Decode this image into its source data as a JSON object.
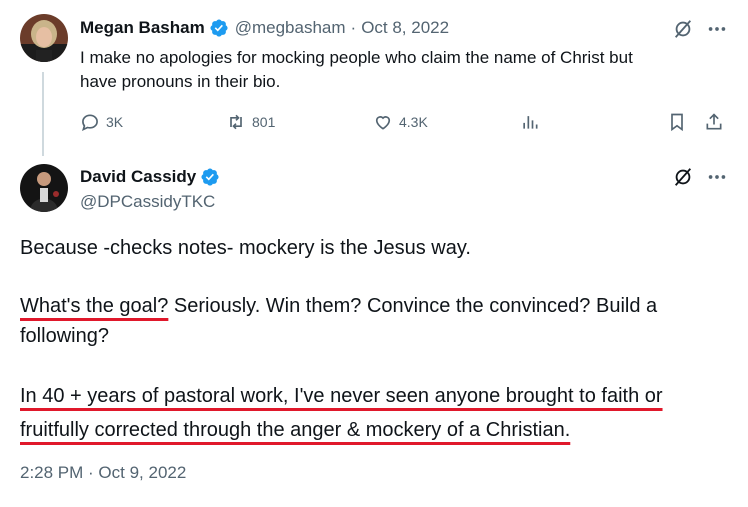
{
  "quoted_post": {
    "author_name": "Megan Basham",
    "handle": "@megbasham",
    "separator": "·",
    "date": "Oct 8, 2022",
    "text_line1": "I make no apologies for mocking people who claim the name of Christ but",
    "text_line2": "have pronouns in their bio.",
    "replies": "3K",
    "reposts": "801",
    "likes": "4.3K"
  },
  "main_post": {
    "author_name": "David Cassidy",
    "handle": "@DPCassidyTKC",
    "para1": "Because -checks notes- mockery is the Jesus way.",
    "para2_underlined": "What's the goal?",
    "para2_rest_line1": " Seriously. Win them? Convince the convinced? Build a",
    "para2_line2": "following?",
    "para3_line1": "In 40 + years of pastoral work, I've never seen anyone brought to faith or",
    "para3_line2": "fruitfully corrected through the anger & mockery of a Christian.",
    "timestamp": "2:28 PM · Oct 9, 2022"
  },
  "colors": {
    "verified": "#1d9bf0",
    "muted": "#536471",
    "annotation_underline": "#e0182b"
  },
  "icons": [
    "verified-badge-icon",
    "grok-icon",
    "more-icon",
    "reply-icon",
    "repost-icon",
    "like-icon",
    "views-icon",
    "bookmark-icon",
    "share-icon"
  ]
}
